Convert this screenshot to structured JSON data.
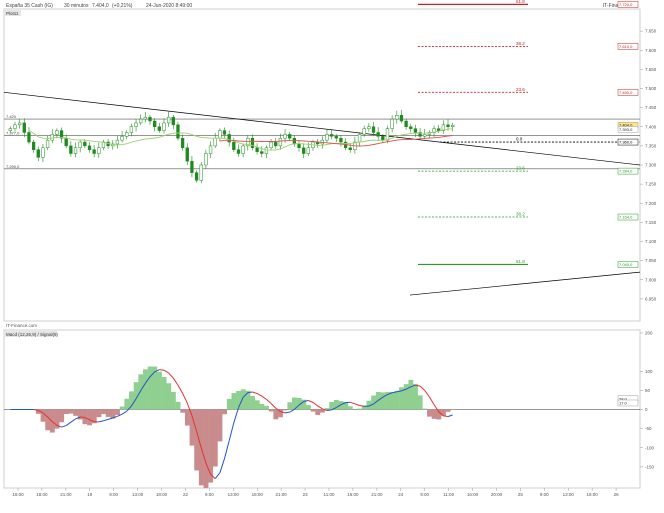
{
  "header": {
    "instrument": "España 35 Cash (IG)",
    "timeframe": "30 minutos",
    "last": "7.404,0",
    "change": "(+0,21%)",
    "datetime": "24-Jun-2020 8:49:00",
    "watermark": "IT-Finance.com",
    "badge": "Plot11"
  },
  "colors": {
    "candle_up": "#1f8a1f",
    "candle_down": "#1f8a1f",
    "ma_green": "#9ad26a",
    "ma_red": "#d9534f",
    "level_red": "#cc2222",
    "level_green": "#2a9a2a",
    "level_black": "#000000",
    "trendline": "#000000",
    "macd_fill_pos": "#8fcf8f",
    "macd_fill_neg": "#c98b8b",
    "macd_signal_blue": "#2255cc",
    "macd_signal_red": "#e23333"
  },
  "chart_data": [
    {
      "type": "candlestick",
      "panel": "price",
      "ylim": [
        6900,
        7700
      ],
      "y_ticks": [
        "7.650",
        "7.600",
        "7.550",
        "7.500",
        "7.450",
        "7.400",
        "7.350",
        "7.300",
        "7.250",
        "7.200",
        "7.150",
        "7.100",
        "7.050",
        "7.000",
        "6.950"
      ],
      "y_tick_values": [
        7650,
        7600,
        7550,
        7500,
        7450,
        7400,
        7350,
        7300,
        7250,
        7200,
        7150,
        7100,
        7050,
        7000,
        6950
      ],
      "left_level_labels": [
        "7.420",
        "7.377,0",
        "7.290,0"
      ],
      "closes": [
        7395,
        7405,
        7410,
        7385,
        7360,
        7340,
        7320,
        7345,
        7365,
        7380,
        7390,
        7370,
        7350,
        7330,
        7345,
        7360,
        7350,
        7340,
        7330,
        7345,
        7360,
        7350,
        7355,
        7365,
        7375,
        7385,
        7400,
        7410,
        7420,
        7425,
        7415,
        7400,
        7390,
        7410,
        7425,
        7405,
        7370,
        7345,
        7310,
        7280,
        7260,
        7300,
        7330,
        7350,
        7370,
        7390,
        7380,
        7360,
        7340,
        7330,
        7350,
        7370,
        7345,
        7335,
        7330,
        7345,
        7360,
        7350,
        7370,
        7380,
        7370,
        7355,
        7345,
        7330,
        7345,
        7360,
        7355,
        7365,
        7380,
        7375,
        7370,
        7360,
        7345,
        7340,
        7360,
        7380,
        7395,
        7400,
        7385,
        7375,
        7365,
        7395,
        7420,
        7430,
        7415,
        7400,
        7395,
        7385,
        7375,
        7380,
        7385,
        7395,
        7390,
        7405,
        7400,
        7404
      ],
      "annotations": [
        {
          "label": "61.8",
          "price": 7720,
          "color": "red",
          "dashed": false,
          "price_label": "7.720,0"
        },
        {
          "label": "38.2",
          "price": 7610,
          "color": "red",
          "dashed": true,
          "price_label": "7.610,0"
        },
        {
          "label": "23.6",
          "price": 7490,
          "color": "red",
          "dashed": true,
          "price_label": "7.490,0"
        },
        {
          "label": "0.0",
          "price": 7360,
          "color": "black",
          "dashed": true,
          "price_label": "7.360,0"
        },
        {
          "label": "23.6",
          "price": 7284,
          "color": "green",
          "dashed": true,
          "price_label": "7.284,0"
        },
        {
          "label": "38.2",
          "price": 7164,
          "color": "green",
          "dashed": true,
          "price_label": "7.164,0"
        },
        {
          "label": "61.8",
          "price": 7040,
          "color": "green",
          "dashed": false,
          "price_label": "7.040,0"
        }
      ],
      "last_price_labels": [
        "7.404,0",
        "7.393,0"
      ]
    },
    {
      "type": "histogram",
      "panel": "oscillator",
      "title": "Macd (12,26,9) / Signal(9)",
      "ylim": [
        -200,
        200
      ],
      "y_ticks": [
        "200",
        "100",
        "50",
        "0",
        "-50",
        "-100",
        "-150"
      ],
      "y_tick_values": [
        200,
        100,
        50,
        0,
        -50,
        -100,
        -150
      ],
      "values_labels": [
        "28.0",
        "17.0"
      ],
      "x_ticks": [
        "16:00",
        "18:00",
        "21:00",
        "19",
        "9:00",
        "13:00",
        "18:00",
        "22",
        "9:00",
        "13:00",
        "18:00",
        "21:00",
        "23",
        "11:00",
        "16:00",
        "21:00",
        "24",
        "9:00",
        "11:00",
        "16:00",
        "20:00",
        "25",
        "9:00",
        "13:00",
        "18:00",
        "26"
      ]
    }
  ]
}
